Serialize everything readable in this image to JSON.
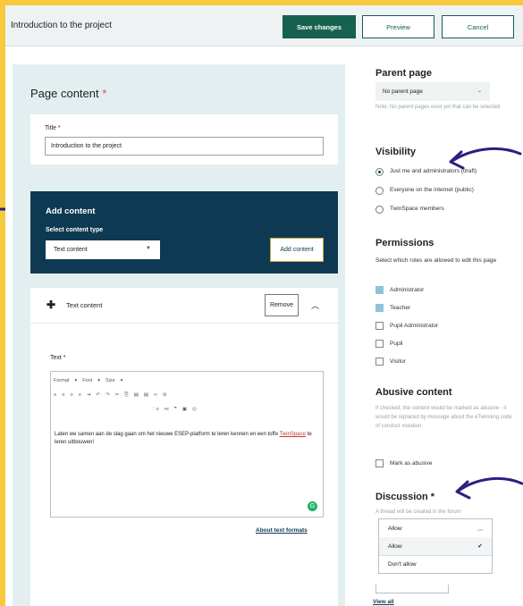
{
  "header": {
    "title": "Introduction to the project",
    "save_label": "Save changes",
    "preview_label": "Preview",
    "cancel_label": "Cancel"
  },
  "page_content": {
    "heading": "Page content",
    "required_mark": "*",
    "title_label": "Title *",
    "title_value": "Introduction to the project"
  },
  "add_content": {
    "heading": "Add content",
    "select_label": "Select content type",
    "selected_type": "Text content",
    "button_label": "Add content"
  },
  "text_block": {
    "header_label": "Text content",
    "remove_label": "Remove",
    "field_label": "Text *",
    "toolbar_format": "Format",
    "toolbar_font": "Font",
    "toolbar_size": "Size",
    "body_pre": "Laten we samen aan de slag gaan om het nieuwe ESEP-platform te leren kennen en een toffe ",
    "body_link": "TwinSpace",
    "body_post": " te leren uitbouwen!",
    "about_link": "About text formats"
  },
  "parent_page": {
    "heading": "Parent page",
    "selected": "No parent page",
    "note": "Note: No parent pages exist yet that can be selected"
  },
  "visibility": {
    "heading": "Visibility",
    "options": [
      {
        "label": "Just me and administrators (draft)",
        "selected": true
      },
      {
        "label": "Everyone on the internet (public)",
        "selected": false
      },
      {
        "label": "TwinSpace members",
        "selected": false
      }
    ]
  },
  "permissions": {
    "heading": "Permissions",
    "description": "Select which roles are allowed to edit this page",
    "roles": [
      {
        "label": "Administrator",
        "checked": true
      },
      {
        "label": "Teacher",
        "checked": true
      },
      {
        "label": "Pupil Administrator",
        "checked": false
      },
      {
        "label": "Pupil",
        "checked": false
      },
      {
        "label": "Visitor",
        "checked": false
      }
    ]
  },
  "abusive": {
    "heading": "Abusive content",
    "description": "If checked, the content would be marked as abusive - it would be replaced by message about the eTwinning code of conduct violation.",
    "checkbox_label": "Mark as abusive"
  },
  "discussion": {
    "heading": "Discussion *",
    "note": "A thread will be created in the forum",
    "current": "Allow",
    "options": [
      "Allow",
      "Don't allow"
    ],
    "view_all": "View all"
  },
  "colors": {
    "frame_bg": "#f7c93c",
    "primary": "#17624f",
    "navy": "#0d3a52",
    "arrow": "#2b2080"
  }
}
